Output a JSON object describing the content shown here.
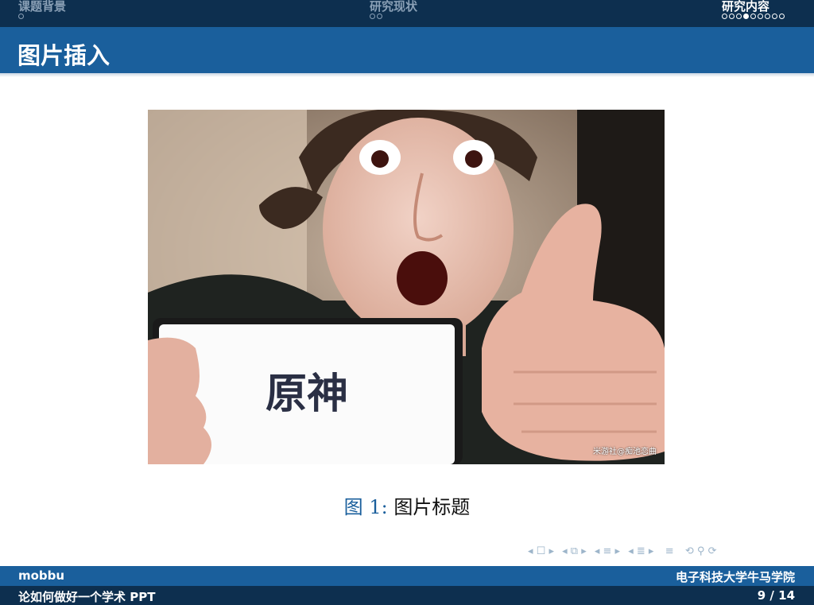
{
  "nav": {
    "sections": [
      {
        "title": "课题背景",
        "dots": 1,
        "filled": -1,
        "active": false
      },
      {
        "title": "研究现状",
        "dots": 2,
        "filled": -1,
        "active": false
      },
      {
        "title": "研究内容",
        "dots": 9,
        "filled": 3,
        "active": true
      }
    ]
  },
  "slide": {
    "title": "图片插入",
    "figure": {
      "watermark": "米游社@痴池恋曲",
      "card_text": "原神"
    },
    "caption": {
      "label": "图",
      "number": "1:",
      "text": "图片标题"
    }
  },
  "beamer_nav_icons": [
    "nav-slide-icon",
    "nav-frame-icon",
    "nav-subsection-icon",
    "nav-section-icon",
    "nav-document-icon",
    "nav-search-icon"
  ],
  "footer": {
    "author": "mobbu",
    "institute": "电子科技大学牛马学院",
    "short_title": "论如何做好一个学术 PPT",
    "page": "9 / 14"
  },
  "colors": {
    "dark_navy": "#0d2f4f",
    "beamer_blue": "#1a5f9c"
  }
}
